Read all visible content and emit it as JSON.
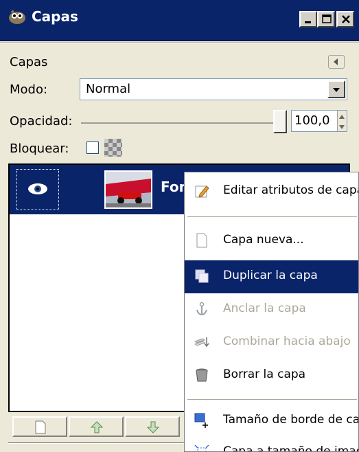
{
  "window": {
    "title": "Capas"
  },
  "panel": {
    "title": "Capas",
    "mode_label": "Modo:",
    "mode_value": "Normal",
    "opacity_label": "Opacidad:",
    "opacity_value": "100,0",
    "opacity_level": 1.0,
    "lock_label": "Bloquear:"
  },
  "layers": [
    {
      "name": "Fondo",
      "visible": true
    }
  ],
  "bottom_buttons": [
    {
      "icon": "new-layer-icon"
    },
    {
      "icon": "raise-icon"
    },
    {
      "icon": "lower-icon"
    }
  ],
  "context_menu": {
    "items": [
      {
        "label": "Editar atributos de capa...",
        "icon": "edit-icon",
        "enabled": true,
        "selected": false
      },
      {
        "label": "Capa nueva...",
        "icon": "new-page-icon",
        "enabled": true,
        "selected": false
      },
      {
        "label": "Duplicar la capa",
        "icon": "duplicate-icon",
        "enabled": true,
        "selected": true
      },
      {
        "label": "Anclar la capa",
        "icon": "anchor-icon",
        "enabled": false,
        "selected": false
      },
      {
        "label": "Combinar hacia abajo",
        "icon": "merge-down-icon",
        "enabled": false,
        "selected": false
      },
      {
        "label": "Borrar la capa",
        "icon": "trash-icon",
        "enabled": true,
        "selected": false
      },
      {
        "label": "Tamaño de borde de capa...",
        "icon": "border-size-icon",
        "enabled": true,
        "selected": false
      },
      {
        "label": "Capa a tamaño de imagen",
        "icon": "layer-to-image-icon",
        "enabled": true,
        "selected": false
      }
    ]
  },
  "colors": {
    "titlebar": "#0a246a",
    "selection": "#0a246a",
    "window_bg": "#ece9d8"
  }
}
